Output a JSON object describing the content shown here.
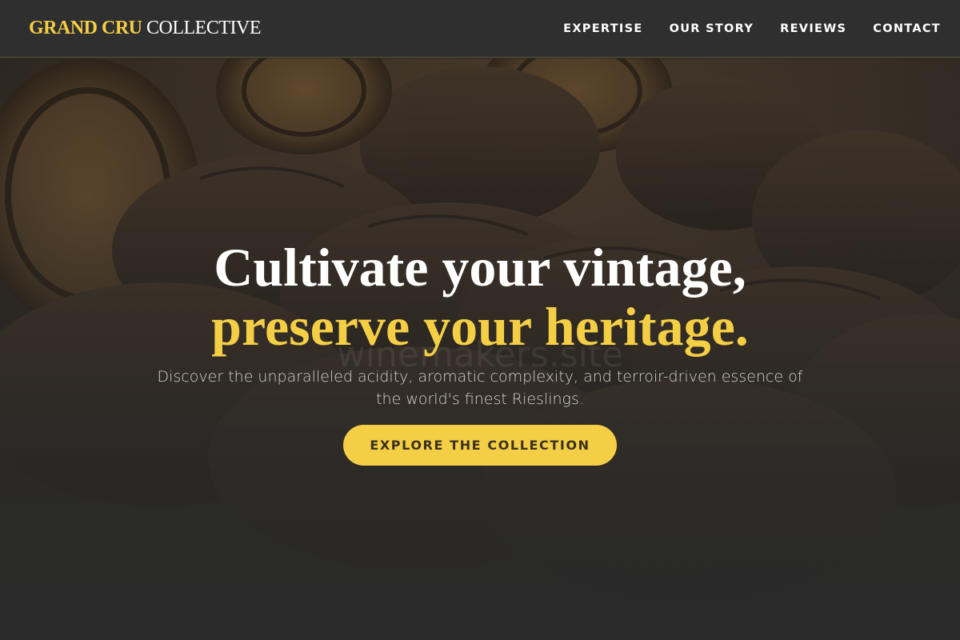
{
  "brand": {
    "name_accent": "GRAND CRU",
    "name_rest": "COLLECTIVE",
    "accent_color": "#f4cf45"
  },
  "nav": {
    "items": [
      {
        "label": "EXPERTISE"
      },
      {
        "label": "OUR STORY"
      },
      {
        "label": "REVIEWS"
      },
      {
        "label": "CONTACT"
      }
    ]
  },
  "hero": {
    "headline_line1": "Cultivate your vintage,",
    "headline_line2": "preserve your heritage.",
    "watermark": "winemakers.site",
    "subtitle": "Discover the unparalleled acidity, aromatic complexity, and terroir-driven essence of the world's finest Rieslings.",
    "cta_label": "EXPLORE THE COLLECTION",
    "background": "wine-barrels-cellar-photo"
  }
}
